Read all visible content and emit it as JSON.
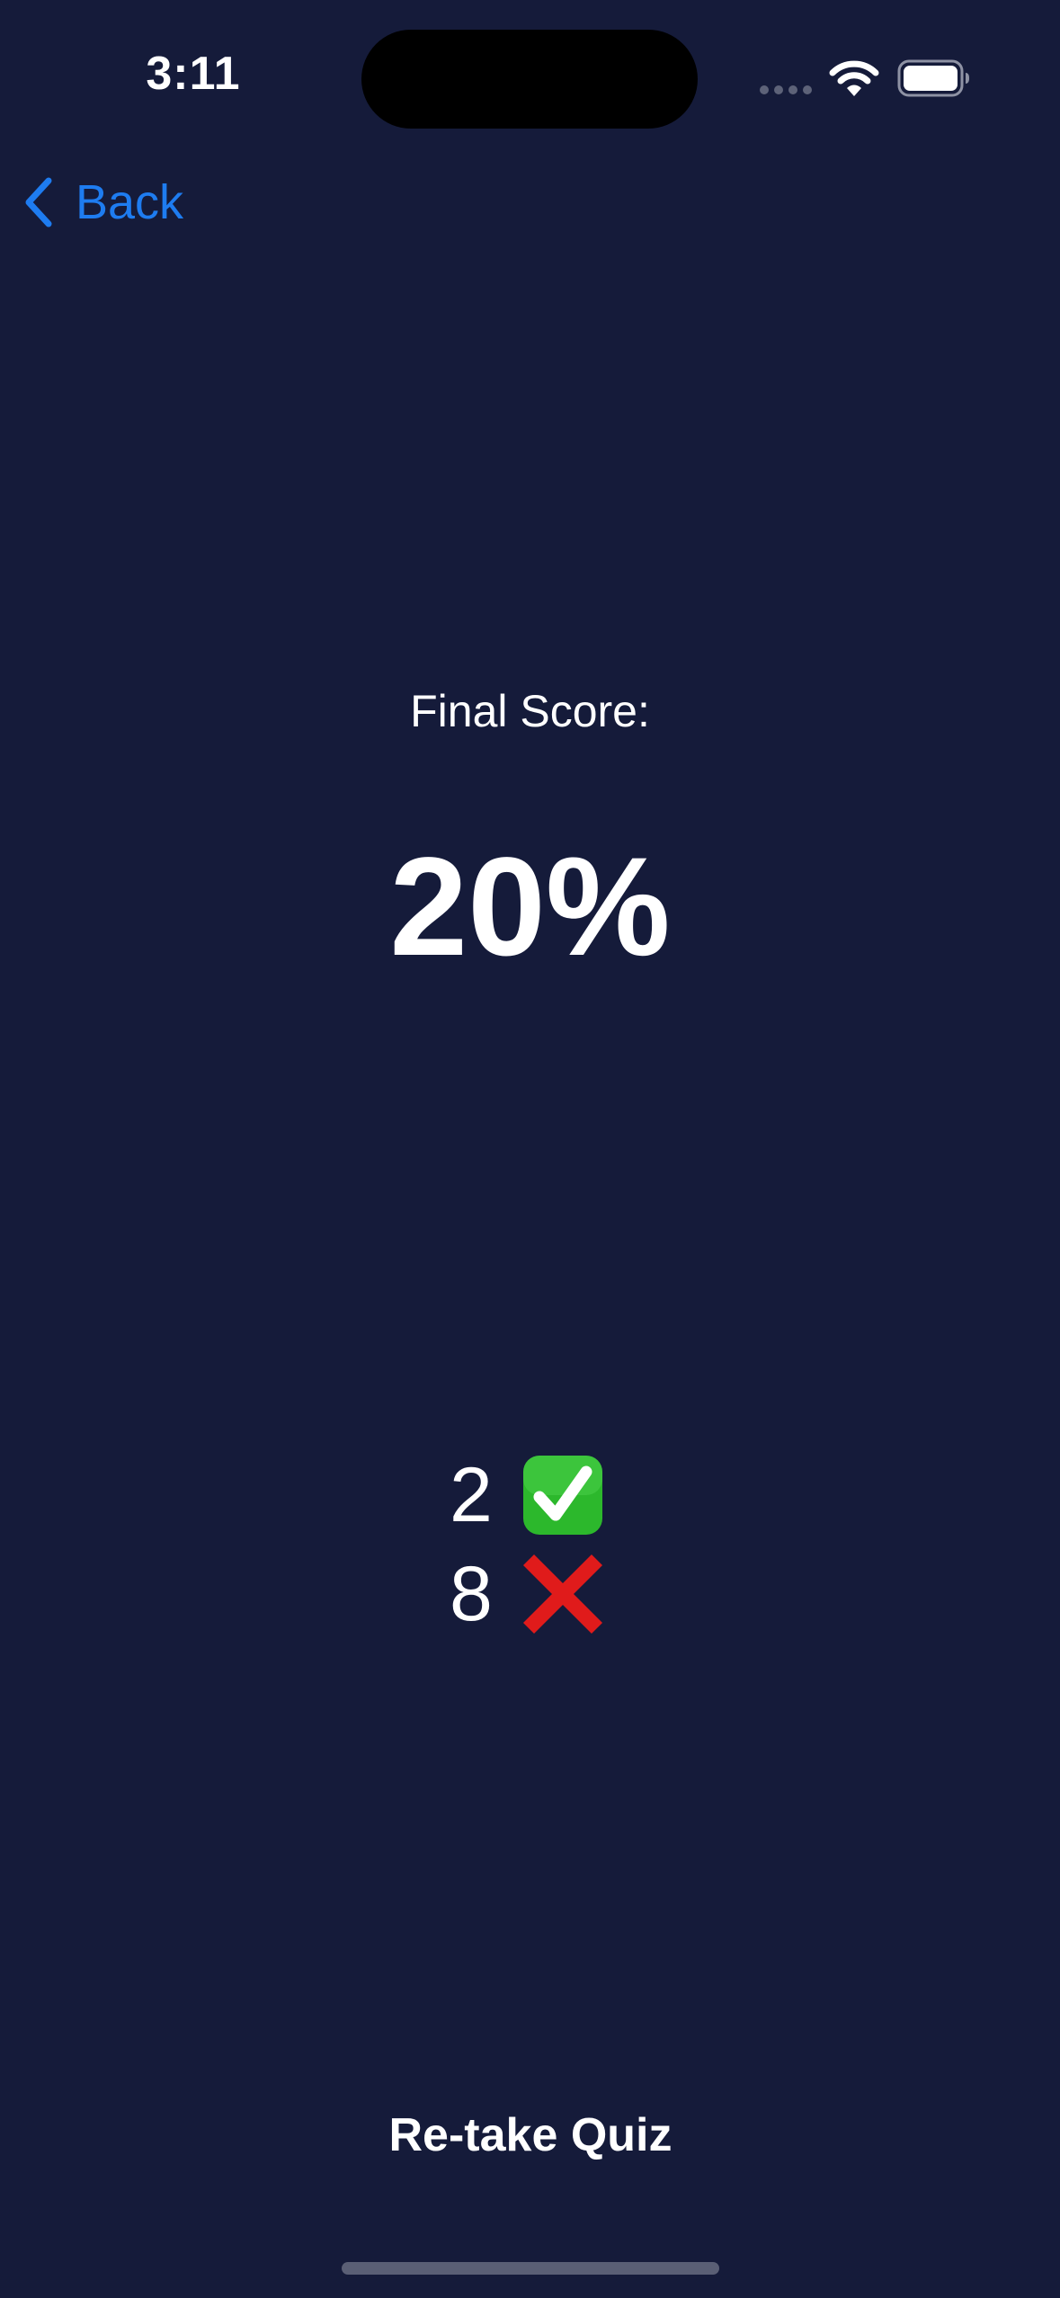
{
  "status_bar": {
    "time": "3:11",
    "icons": [
      "signal-dots-icon",
      "wifi-icon",
      "battery-icon"
    ]
  },
  "nav": {
    "back_label": "Back",
    "back_icon": "chevron-left-icon",
    "accent_color": "#1e7cf0"
  },
  "result": {
    "label": "Final Score:",
    "score": "20%",
    "correct_count": "2",
    "incorrect_count": "8",
    "correct_icon": "check-mark-button-icon",
    "incorrect_icon": "cross-mark-icon"
  },
  "actions": {
    "retake_label": "Re-take Quiz"
  },
  "colors": {
    "background": "#151b3a",
    "text": "#ffffff",
    "correct": "#2cb82c",
    "incorrect": "#e01b1b"
  }
}
